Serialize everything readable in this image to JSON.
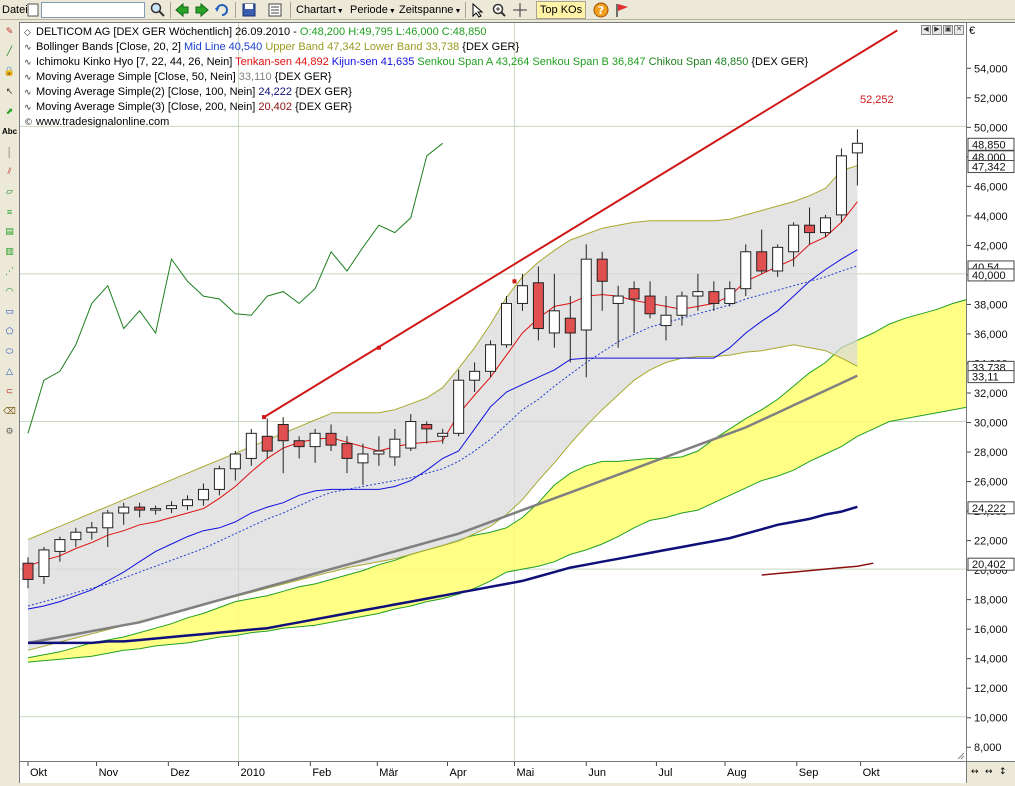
{
  "toolbar": {
    "file_menu": "Datei",
    "symbol_input": "",
    "charttype_menu": "Chartart",
    "period_menu": "Periode",
    "timespan_menu": "Zeitspanne",
    "topko_label": "Top KOs"
  },
  "left_tools": [
    "pencil-icon",
    "line-icon",
    "lock-icon",
    "cursor-icon",
    "up-arrow-icon",
    "text-icon",
    "vertical-line-icon",
    "parallel-lines-icon",
    "channel-icon",
    "fibonacci-icon",
    "gann-icon",
    "andrews-icon",
    "fan-icon",
    "arc-icon",
    "rectangle-icon",
    "polygon-icon",
    "ellipse-icon",
    "triangle-icon",
    "magnet-icon",
    "eraser-icon",
    "settings-icon"
  ],
  "chart": {
    "header": "DELTICOM AG [DEX GER  Wöchentlich] 26.09.2010 - ",
    "header_ohlc": "O:48,200 H:49,795 L:46,000 C:48,850",
    "bollinger_prefix": "Bollinger Bands [Close, 20, 2] ",
    "bollinger_mid": "Mid Line 40,540",
    "bollinger_upper": "Upper Band 47,342",
    "bollinger_lower": "Lower Band 33,738",
    "bollinger_suffix": " {DEX GER}",
    "ichimoku_prefix": "Ichimoku Kinko Hyo [7, 22, 44, 26, Nein] ",
    "ichimoku_tenkan": "Tenkan-sen 44,892",
    "ichimoku_kijun": "Kijun-sen 41,635",
    "ichimoku_span_a": "Senkou Span A 43,264",
    "ichimoku_span_b": "Senkou Span B 36,847",
    "ichimoku_chikou": "Chikou Span 48,850",
    "ichimoku_suffix": " {DEX GER}",
    "ma50_prefix": "Moving Average Simple [Close, 50, Nein] ",
    "ma50_value": "33,110",
    "ma50_suffix": " {DEX GER}",
    "ma100_prefix": "Moving Average Simple(2) [Close, 100, Nein] ",
    "ma100_value": "24,222",
    "ma100_suffix": " {DEX GER}",
    "ma200_prefix": "Moving Average Simple(3) [Close, 200, Nein] ",
    "ma200_value": "20,402",
    "ma200_suffix": " {DEX GER}",
    "watermark": "www.tradesignalonline.com",
    "trendline_label": "52,252",
    "currency": "€",
    "colors": {
      "bull": "#ffffff",
      "bear": "#e05050",
      "bollinger_band": "#a9a92f",
      "bollinger_fill": "#d8d8d8",
      "tenkan": "#e01010",
      "kijun": "#1010e0",
      "kumo": "#ffff70",
      "span_line": "#20a020",
      "chikou": "#208020",
      "ma50": "#808080",
      "ma100": "#10107a",
      "ma200": "#8a1010",
      "trendline": "#d01818",
      "grid": "#c8d8c0"
    }
  },
  "chart_data": {
    "type": "candlestick",
    "y_ticks": [
      "54,000",
      "52,000",
      "50,000",
      "48,000",
      "46,000",
      "44,000",
      "42,000",
      "40,000",
      "38,000",
      "36,000",
      "34,000",
      "32,000",
      "30,000",
      "28,000",
      "26,000",
      "24,000",
      "22,000",
      "20,000",
      "18,000",
      "16,000",
      "14,000",
      "12,000",
      "10,000",
      "8,000"
    ],
    "y_values": [
      54,
      52,
      50,
      48,
      46,
      44,
      42,
      40,
      38,
      36,
      34,
      32,
      30,
      28,
      26,
      24,
      22,
      20,
      18,
      16,
      14,
      12,
      10,
      8
    ],
    "ylim": [
      7,
      57
    ],
    "x_labels": [
      "Okt",
      "Nov",
      "Dez",
      "2010",
      "Feb",
      "Mär",
      "Apr",
      "Mai",
      "Jun",
      "Jul",
      "Aug",
      "Sep",
      "Okt"
    ],
    "x_label_index": [
      0,
      4.3,
      8.8,
      13.2,
      17.7,
      21.9,
      26.3,
      30.5,
      35.0,
      39.4,
      43.7,
      48.2,
      52.2
    ],
    "axis_tags": [
      {
        "label": "48,850",
        "value": 48.85,
        "bg": "#ffffff"
      },
      {
        "label": "48,000",
        "value": 48.0,
        "bg": "#ffffff"
      },
      {
        "label": "47,342",
        "value": 47.342,
        "bg": "#ffffff"
      },
      {
        "label": "40,54",
        "value": 40.54,
        "bg": "#ffffff"
      },
      {
        "label": "40,000",
        "value": 40.0,
        "bg": "#ffffff"
      },
      {
        "label": "33,738",
        "value": 33.738,
        "bg": "#ffffff"
      },
      {
        "label": "33,11",
        "value": 33.11,
        "bg": "#ffffff"
      },
      {
        "label": "24,222",
        "value": 24.222,
        "bg": "#ffffff"
      },
      {
        "label": "20,402",
        "value": 20.402,
        "bg": "#ffffff"
      }
    ],
    "candles": [
      [
        20.4,
        20.8,
        18.7,
        19.3
      ],
      [
        19.5,
        21.5,
        19.0,
        21.3
      ],
      [
        21.2,
        22.2,
        20.5,
        22.0
      ],
      [
        22.0,
        22.8,
        21.5,
        22.5
      ],
      [
        22.5,
        23.2,
        22.0,
        22.8
      ],
      [
        22.8,
        24.0,
        21.5,
        23.8
      ],
      [
        23.8,
        24.5,
        23.0,
        24.2
      ],
      [
        24.2,
        24.5,
        23.5,
        24.0
      ],
      [
        24.0,
        24.3,
        23.7,
        24.1
      ],
      [
        24.1,
        24.6,
        23.8,
        24.3
      ],
      [
        24.3,
        25.0,
        24.0,
        24.7
      ],
      [
        24.7,
        25.8,
        24.3,
        25.4
      ],
      [
        25.4,
        27.0,
        25.0,
        26.8
      ],
      [
        26.8,
        28.0,
        26.0,
        27.8
      ],
      [
        27.5,
        29.5,
        27.0,
        29.2
      ],
      [
        29.0,
        30.2,
        27.5,
        28.0
      ],
      [
        29.8,
        30.3,
        26.5,
        28.7
      ],
      [
        28.7,
        29.0,
        27.5,
        28.3
      ],
      [
        28.3,
        29.5,
        27.2,
        29.2
      ],
      [
        29.2,
        29.8,
        28.0,
        28.4
      ],
      [
        28.5,
        29.0,
        26.5,
        27.5
      ],
      [
        27.2,
        28.5,
        25.7,
        27.8
      ],
      [
        27.8,
        29.0,
        27.0,
        28.0
      ],
      [
        27.6,
        29.5,
        27.0,
        28.8
      ],
      [
        28.2,
        30.5,
        28.0,
        30.0
      ],
      [
        29.8,
        30.0,
        28.5,
        29.5
      ],
      [
        29.0,
        29.5,
        28.5,
        29.2
      ],
      [
        29.2,
        33.5,
        29.0,
        32.8
      ],
      [
        32.8,
        34.0,
        32.0,
        33.4
      ],
      [
        33.4,
        35.5,
        33.0,
        35.2
      ],
      [
        35.2,
        38.5,
        35.0,
        38.0
      ],
      [
        38.0,
        40.0,
        37.5,
        39.2
      ],
      [
        39.4,
        40.5,
        35.5,
        36.3
      ],
      [
        36.0,
        40.0,
        35.0,
        37.5
      ],
      [
        37.0,
        38.5,
        34.0,
        36.0
      ],
      [
        36.2,
        42.0,
        33.0,
        41.0
      ],
      [
        41.0,
        41.5,
        37.5,
        39.5
      ],
      [
        38.0,
        39.2,
        35.0,
        38.5
      ],
      [
        39.0,
        39.5,
        36.0,
        38.3
      ],
      [
        38.5,
        39.5,
        37.0,
        37.3
      ],
      [
        36.5,
        38.5,
        35.5,
        37.2
      ],
      [
        37.2,
        38.8,
        36.5,
        38.5
      ],
      [
        38.5,
        40.0,
        37.5,
        38.8
      ],
      [
        38.8,
        39.5,
        37.5,
        38.0
      ],
      [
        38.0,
        39.5,
        37.8,
        39.0
      ],
      [
        39.0,
        42.0,
        38.5,
        41.5
      ],
      [
        41.5,
        43.0,
        40.0,
        40.2
      ],
      [
        40.2,
        42.0,
        39.8,
        41.8
      ],
      [
        41.5,
        43.5,
        40.5,
        43.3
      ],
      [
        43.3,
        44.5,
        42.0,
        42.8
      ],
      [
        42.8,
        44.0,
        42.5,
        43.8
      ],
      [
        44.0,
        48.5,
        43.5,
        48.0
      ],
      [
        48.2,
        49.8,
        46.0,
        48.85
      ]
    ],
    "bollinger_upper": [
      null,
      null,
      null,
      null,
      null,
      null,
      null,
      null,
      null,
      null,
      null,
      null,
      null,
      null,
      null,
      null,
      null,
      null,
      null,
      30.6,
      30.6,
      30.6,
      30.6,
      30.8,
      31.2,
      31.6,
      32.3,
      33.6,
      35.0,
      36.6,
      38.4,
      39.8,
      40.8,
      41.6,
      42.3,
      42.7,
      43.1,
      43.3,
      43.5,
      43.6,
      43.6,
      43.6,
      43.6,
      43.6,
      43.7,
      44.0,
      44.3,
      44.6,
      44.9,
      45.3,
      45.8,
      47.0,
      47.34
    ],
    "bollinger_lower": [
      null,
      null,
      null,
      null,
      null,
      null,
      null,
      null,
      null,
      null,
      null,
      null,
      null,
      null,
      null,
      null,
      null,
      null,
      null,
      19.8,
      20.1,
      20.3,
      20.5,
      20.7,
      21.0,
      21.3,
      21.6,
      21.9,
      22.4,
      22.9,
      23.7,
      24.7,
      26.0,
      27.2,
      28.5,
      29.7,
      30.8,
      31.8,
      32.8,
      33.5,
      34.0,
      34.3,
      34.4,
      34.4,
      34.5,
      34.7,
      34.8,
      35.0,
      35.2,
      35.0,
      34.8,
      34.3,
      33.74
    ],
    "bollinger_mid": [
      17.5,
      17.8,
      18.1,
      18.4,
      18.7,
      19.0,
      19.4,
      19.8,
      20.2,
      20.6,
      21.0,
      21.4,
      21.9,
      22.4,
      22.9,
      23.4,
      23.8,
      24.3,
      24.8,
      25.2,
      25.4,
      25.6,
      25.8,
      26.0,
      26.2,
      26.5,
      26.8,
      27.3,
      28.0,
      28.8,
      29.8,
      30.8,
      31.5,
      32.4,
      33.2,
      34.0,
      34.7,
      35.4,
      35.9,
      36.4,
      36.7,
      37.0,
      37.3,
      37.6,
      37.9,
      38.3,
      38.6,
      38.9,
      39.2,
      39.5,
      39.8,
      40.2,
      40.54
    ],
    "tenkan": [
      20.2,
      20.6,
      20.9,
      21.4,
      21.8,
      22.3,
      22.6,
      23.0,
      23.2,
      23.5,
      23.8,
      24.1,
      24.8,
      25.6,
      26.6,
      27.5,
      28.2,
      28.6,
      28.8,
      28.9,
      28.6,
      28.3,
      28.0,
      28.3,
      28.5,
      28.6,
      28.7,
      30.5,
      31.8,
      33.0,
      34.5,
      36.0,
      37.0,
      37.8,
      38.0,
      38.5,
      38.6,
      38.5,
      38.2,
      38.0,
      37.8,
      37.6,
      37.8,
      38.0,
      38.5,
      39.5,
      40.0,
      40.5,
      41.0,
      42.0,
      42.5,
      43.5,
      44.89
    ],
    "kijun": [
      17.3,
      17.5,
      17.8,
      18.2,
      18.6,
      19.2,
      19.8,
      20.5,
      21.2,
      21.7,
      22.2,
      22.6,
      22.8,
      23.2,
      23.8,
      24.2,
      24.5,
      25.0,
      25.3,
      25.4,
      25.4,
      25.4,
      25.4,
      25.6,
      26.0,
      26.7,
      27.5,
      28.0,
      29.5,
      31.0,
      32.0,
      32.5,
      33.0,
      33.5,
      34.2,
      34.3,
      34.3,
      34.3,
      34.3,
      34.3,
      34.3,
      34.3,
      34.3,
      34.3,
      35.0,
      36.0,
      36.8,
      37.5,
      38.5,
      39.5,
      40.3,
      41.0,
      41.64
    ],
    "span_a": [
      14.0,
      14.2,
      14.4,
      14.7,
      15.0,
      15.2,
      15.4,
      15.7,
      16.0,
      16.3,
      16.7,
      17.0,
      17.4,
      17.8,
      18.0,
      18.2,
      18.5,
      18.8,
      19.0,
      19.3,
      19.6,
      19.9,
      20.3,
      20.6,
      21.0,
      21.3,
      21.6,
      22.0,
      22.3,
      22.5,
      22.8,
      23.5,
      24.5,
      25.7,
      26.5,
      27.0,
      27.3,
      27.3,
      27.4,
      27.5,
      27.5,
      27.6,
      28.0,
      28.8,
      29.5,
      30.2,
      30.8,
      31.5,
      32.4,
      33.3,
      34.0,
      35.0,
      35.5,
      36.0,
      36.6,
      37.0,
      37.3,
      37.6,
      38.0,
      38.3,
      38.6,
      38.8,
      39.5,
      40.5,
      41.5,
      42.3,
      43.0,
      43.5,
      43.8,
      44.0,
      44.0,
      44.0,
      43.26
    ],
    "span_b": [
      13.7,
      13.8,
      13.9,
      14.0,
      14.1,
      14.3,
      14.5,
      14.6,
      14.8,
      14.9,
      15.0,
      15.2,
      15.4,
      15.5,
      15.7,
      15.8,
      16.0,
      16.1,
      16.2,
      16.4,
      16.6,
      16.8,
      17.0,
      17.3,
      17.5,
      17.8,
      18.0,
      18.3,
      18.7,
      19.2,
      19.8,
      20.0,
      20.2,
      20.5,
      21.0,
      21.3,
      21.7,
      22.2,
      22.8,
      23.3,
      23.5,
      23.8,
      24.0,
      24.5,
      25.0,
      25.5,
      26.0,
      26.3,
      26.7,
      27.3,
      27.8,
      28.3,
      29.0,
      29.5,
      30.0,
      30.2,
      30.4,
      30.6,
      30.8,
      31.0,
      31.3,
      31.6,
      31.9,
      32.1,
      32.3,
      32.7,
      33.0,
      33.5,
      34.0,
      34.5,
      35.0,
      35.5,
      36.85
    ],
    "chikou_offset": -26,
    "ma50": [
      15.0,
      15.2,
      15.4,
      15.6,
      15.8,
      16.0,
      16.2,
      16.4,
      16.7,
      17.0,
      17.3,
      17.6,
      17.9,
      18.2,
      18.5,
      18.8,
      19.1,
      19.4,
      19.7,
      20.0,
      20.3,
      20.6,
      20.9,
      21.2,
      21.5,
      21.8,
      22.1,
      22.4,
      22.8,
      23.2,
      23.6,
      24.0,
      24.4,
      24.8,
      25.2,
      25.6,
      26.0,
      26.4,
      26.8,
      27.2,
      27.6,
      28.0,
      28.4,
      28.8,
      29.2,
      29.6,
      30.1,
      30.6,
      31.1,
      31.6,
      32.1,
      32.6,
      33.11
    ],
    "ma100": [
      15.0,
      15.0,
      15.0,
      15.0,
      15.0,
      15.1,
      15.1,
      15.2,
      15.3,
      15.4,
      15.5,
      15.6,
      15.7,
      15.8,
      15.9,
      16.0,
      16.2,
      16.4,
      16.6,
      16.8,
      17.0,
      17.2,
      17.4,
      17.6,
      17.8,
      18.0,
      18.2,
      18.4,
      18.6,
      18.8,
      19.0,
      19.2,
      19.5,
      19.8,
      20.1,
      20.3,
      20.5,
      20.7,
      20.9,
      21.1,
      21.3,
      21.5,
      21.7,
      21.9,
      22.1,
      22.4,
      22.7,
      23.0,
      23.2,
      23.4,
      23.7,
      23.9,
      24.22
    ],
    "ma200_start": 46,
    "ma200": [
      19.6,
      19.7,
      19.8,
      19.9,
      20.0,
      20.1,
      20.2,
      20.4
    ],
    "trendline": {
      "x0": 14.8,
      "y0": 30.3,
      "x1": 54.5,
      "y1": 56.5,
      "dots": [
        [
          14.8,
          30.3
        ],
        [
          22.0,
          35.0
        ],
        [
          30.5,
          39.5
        ]
      ]
    }
  }
}
